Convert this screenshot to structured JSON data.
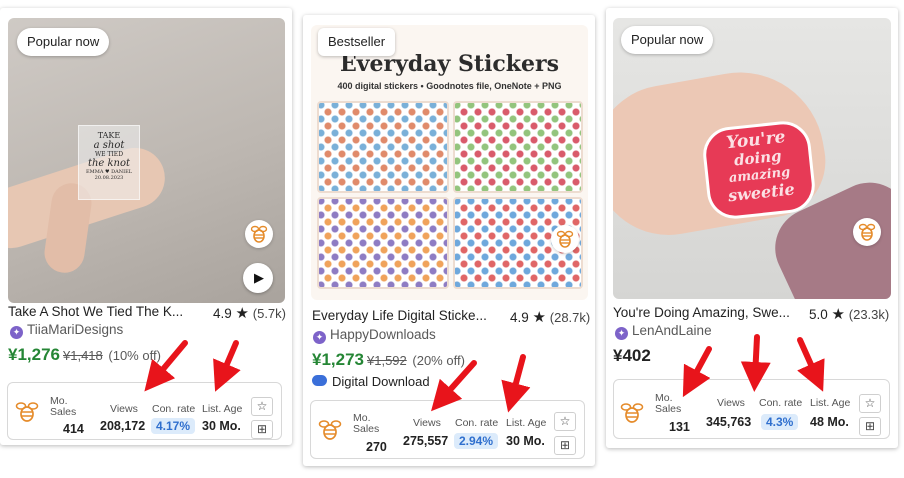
{
  "cards": [
    {
      "badge": "Popular now",
      "title": "Take A Shot We Tied The K...",
      "rating": "4.9",
      "rating_count": "(5.7k)",
      "shop": "TiiaMariDesigns",
      "price": "¥1,276",
      "original_price": "¥1,418",
      "discount": "(10% off)",
      "sticker_lines": [
        "TAKE",
        "a shot",
        "WE TIED",
        "the knot",
        "EMMA ♥ DANIEL",
        "20.08.2023"
      ],
      "stats": {
        "mo_sales_label": "Mo. Sales",
        "mo_sales": "414",
        "views_label": "Views",
        "views": "208,172",
        "conv_label": "Con. rate",
        "conv": "4.17%",
        "age_label": "List. Age",
        "age": "30 Mo."
      }
    },
    {
      "badge": "Bestseller",
      "title": "Everyday Life Digital Sticke...",
      "rating": "4.9",
      "rating_count": "(28.7k)",
      "shop": "HappyDownloads",
      "price": "¥1,273",
      "original_price": "¥1,592",
      "discount": "(20% off)",
      "digital": "Digital Download",
      "image_heading": "Everyday Stickers",
      "image_subheading": "400 digital stickers  •  Goodnotes file, OneNote + PNG",
      "stats": {
        "mo_sales_label": "Mo. Sales",
        "mo_sales": "270",
        "views_label": "Views",
        "views": "275,557",
        "conv_label": "Con. rate",
        "conv": "2.94%",
        "age_label": "List. Age",
        "age": "30 Mo."
      }
    },
    {
      "badge": "Popular now",
      "title": "You're Doing Amazing, Swe...",
      "rating": "5.0",
      "rating_count": "(23.3k)",
      "shop": "LenAndLaine",
      "price": "¥402",
      "sticker_lines": [
        "You're",
        "doing",
        "amazing",
        "sweetie"
      ],
      "stats": {
        "mo_sales_label": "Mo. Sales",
        "mo_sales": "131",
        "views_label": "Views",
        "views": "345,763",
        "conv_label": "Con. rate",
        "conv": "4.3%",
        "age_label": "List. Age",
        "age": "48 Mo."
      }
    }
  ],
  "icons": {
    "star": "★",
    "favorite": "☆",
    "add_to_list": "⊞",
    "play": "▶",
    "seller": "✦"
  },
  "colors": {
    "sale_price": "#258635",
    "conversion_pill_bg": "#dcebfb",
    "conversion_pill_text": "#2f6fce",
    "annotation_arrow": "#e8141b",
    "star_seller": "#7d63c9"
  }
}
